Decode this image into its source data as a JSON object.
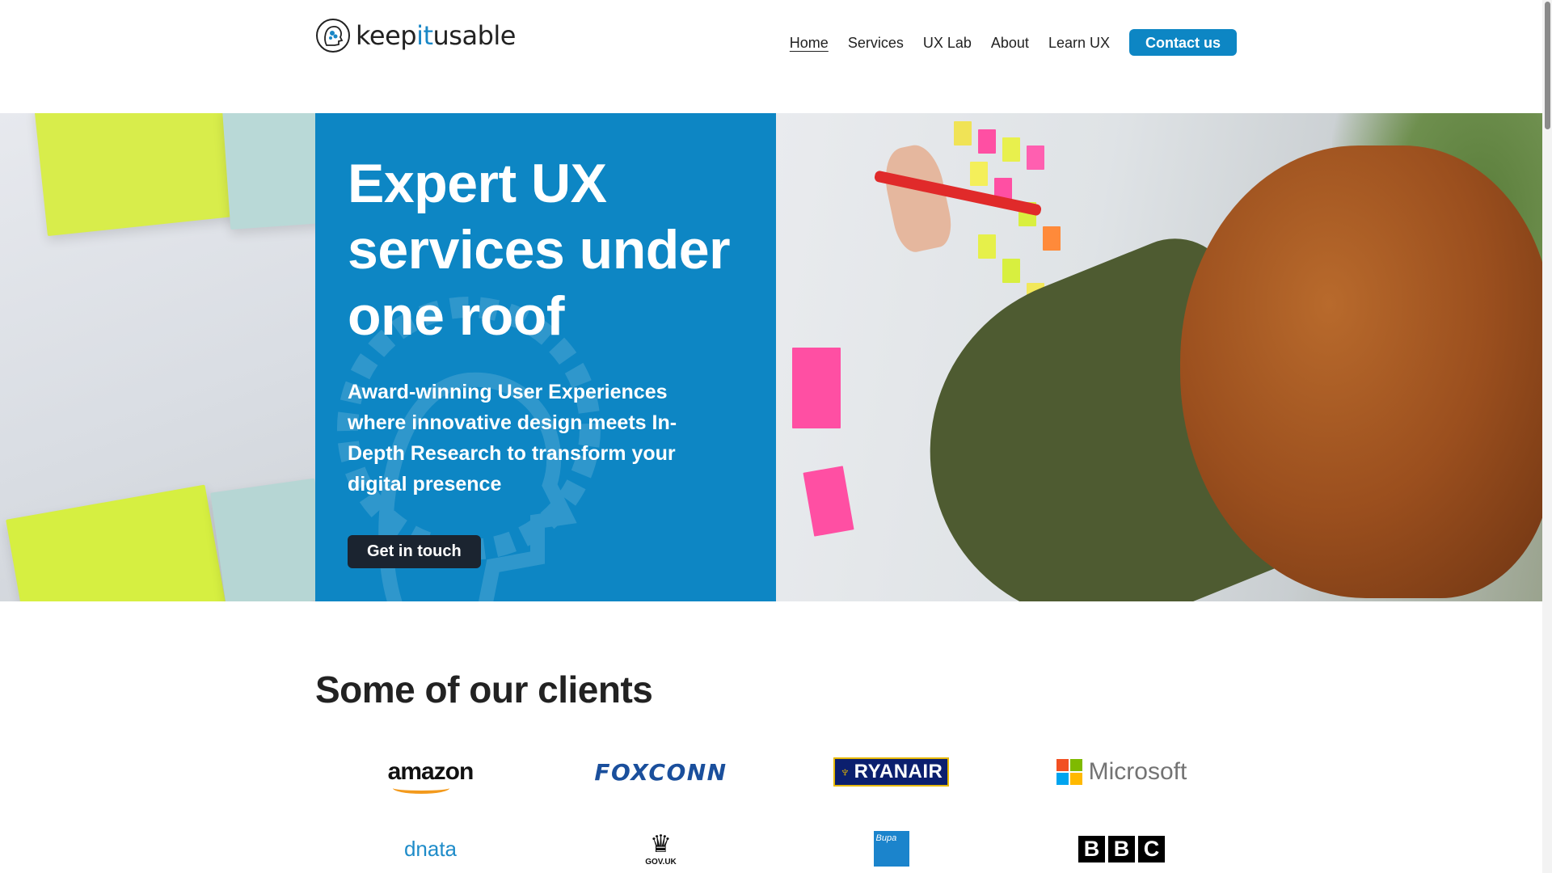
{
  "brand": {
    "name_prefix": "keep",
    "name_accent": "it",
    "name_suffix": "usable"
  },
  "nav": {
    "items": [
      {
        "label": "Home",
        "active": true
      },
      {
        "label": "Services",
        "active": false
      },
      {
        "label": "UX Lab",
        "active": false
      },
      {
        "label": "About",
        "active": false
      },
      {
        "label": "Learn UX",
        "active": false
      }
    ],
    "contact_label": "Contact us"
  },
  "hero": {
    "title": "Expert UX services under one roof",
    "subtitle": "Award-winning User Experiences where innovative design meets In-Depth Research to transform your digital presence",
    "button_label": "Get in touch",
    "panel_color": "#0d86c4"
  },
  "clients": {
    "title": "Some of our clients",
    "logos": [
      {
        "name": "amazon",
        "text": "amazon"
      },
      {
        "name": "foxconn",
        "text": "FOXCONN"
      },
      {
        "name": "ryanair",
        "text": "RYANAIR"
      },
      {
        "name": "microsoft",
        "text": "Microsoft"
      },
      {
        "name": "dnata",
        "text": "dnata"
      },
      {
        "name": "gov-uk",
        "text": "GOV.UK"
      },
      {
        "name": "bupa",
        "text": "Bupa"
      },
      {
        "name": "bbc",
        "letters": [
          "B",
          "B",
          "C"
        ]
      }
    ]
  },
  "colors": {
    "accent": "#0d86c4",
    "button_dark": "#1b2430",
    "text": "#222222"
  }
}
